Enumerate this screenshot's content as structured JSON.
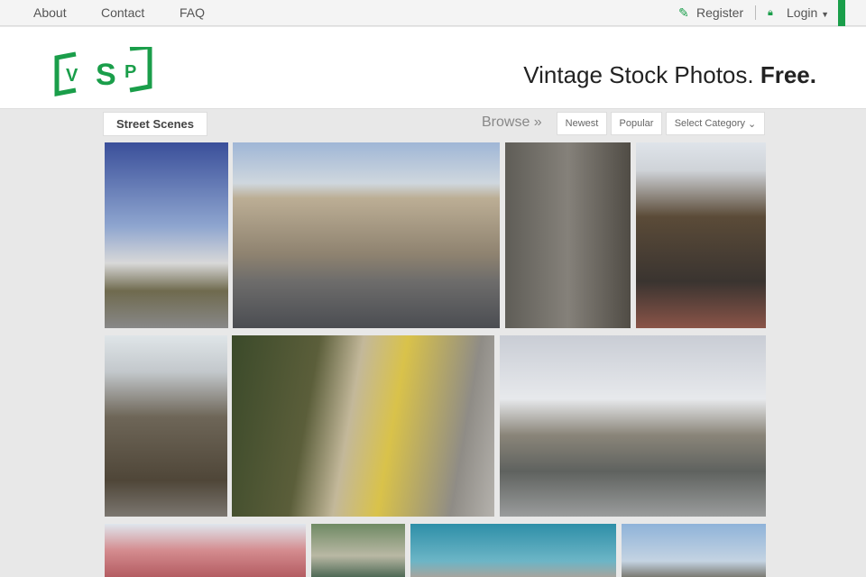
{
  "nav": {
    "about": "About",
    "contact": "Contact",
    "faq": "FAQ",
    "register": "Register",
    "login": "Login"
  },
  "header": {
    "logo_text": "VSP",
    "tagline_main": "Vintage Stock Photos.",
    "tagline_bold": "Free."
  },
  "toolbar": {
    "category_title": "Street Scenes",
    "browse": "Browse »",
    "newest": "Newest",
    "popular": "Popular",
    "select_category": "Select Category"
  },
  "colors": {
    "brand": "#1a9e4a"
  }
}
